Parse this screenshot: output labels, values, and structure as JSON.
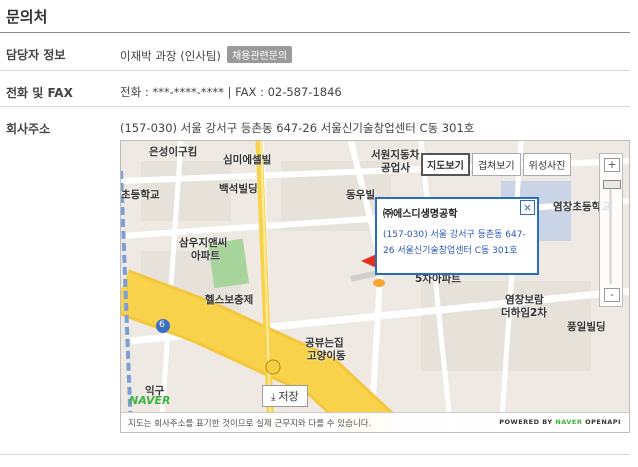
{
  "section_title": "문의처",
  "contact": {
    "label": "담당자 정보",
    "value": "이재박 과장 (인사팀)",
    "badge": "채용관련문의"
  },
  "phone": {
    "label": "전화 및 FAX",
    "value": "전화 : ***-****-**** | FAX : 02-587-1846"
  },
  "address": {
    "label": "회사주소",
    "value": "(157-030) 서울 강서구 등촌동 647-26 서울신기술창업센터 C동 301호"
  },
  "map": {
    "toggles": [
      "지도보기",
      "겹쳐보기",
      "위성사진"
    ],
    "active_toggle": "지도보기",
    "zoom_in": "+",
    "zoom_out": "-",
    "labels": {
      "eunseong": "은성이구킴",
      "simmi": "심미에셀빌",
      "seowon": "서원지동차",
      "seowon2": "공업사",
      "baekseok": "백석빌딩",
      "chodeung": "초등학교",
      "dongwoo": "동우빌",
      "yeomchang": "염창초등학교",
      "samu": "삼우지앤씨",
      "apt": "아파트",
      "five": "5차아파트",
      "health": "헬스보충제",
      "yeomchang_bora": "염창보람",
      "deohim": "더하임2차",
      "pungil": "풍일빌딩",
      "gongdeuk": "공뷰는집",
      "goyang": "고양이동",
      "igu": "익구"
    },
    "road_number": "6",
    "save_button": "저장",
    "naver_logo": "NAVER",
    "popup": {
      "name": "㈜에스디생명공학",
      "address": "(157-030) 서울 강서구 등촌동 647-26 서울신기술창업센터 C동 301호",
      "close": "×"
    },
    "footer_note": "지도는 회사주소를 표기한 것이므로 실제 근무지와 다를 수 있습니다.",
    "footer_brand_prefix": "POWERED BY",
    "footer_brand_naver": "NAVER",
    "footer_brand_suffix": "OPENAPI"
  },
  "colors": {
    "popup_border": "#2a6cbf",
    "road_major": "#f7d24a",
    "park": "#a6d49a"
  }
}
